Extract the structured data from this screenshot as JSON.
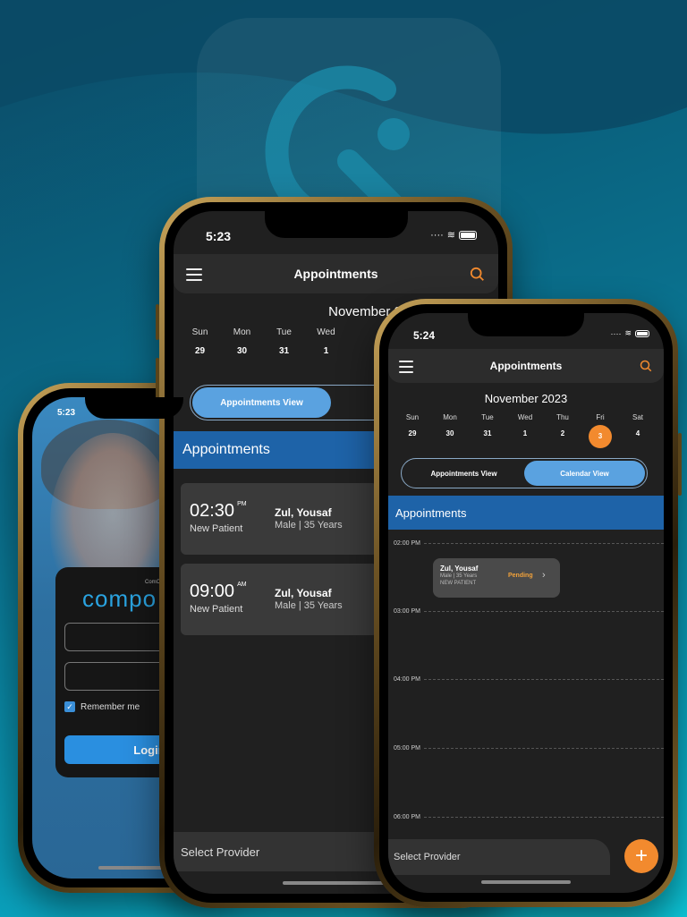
{
  "colors": {
    "accent_orange": "#f28a2e",
    "app_blue": "#1e63a8",
    "segment_active": "#5aa2e0",
    "dark_bg": "#202020"
  },
  "login_phone": {
    "status_time": "5:23",
    "brand_small": "ComCloud",
    "brand": "compo",
    "remember_label": "Remember me",
    "login_button": "Login"
  },
  "list_phone": {
    "status_time": "5:23",
    "header_title": "Appointments",
    "month": "November 2023",
    "days": [
      {
        "name": "Sun",
        "num": "29"
      },
      {
        "name": "Mon",
        "num": "30"
      },
      {
        "name": "Tue",
        "num": "31"
      },
      {
        "name": "Wed",
        "num": "1"
      }
    ],
    "segment_active": "Appointments View",
    "section_title": "Appointments",
    "appointments": [
      {
        "time": "02:30",
        "ampm": "PM",
        "type": "New Patient",
        "name": "Zul, Yousaf",
        "meta": "Male | 35 Years"
      },
      {
        "time": "09:00",
        "ampm": "AM",
        "type": "New Patient",
        "name": "Zul, Yousaf",
        "meta": "Male | 35 Years"
      }
    ],
    "provider_label": "Select Provider"
  },
  "cal_phone": {
    "status_time": "5:24",
    "header_title": "Appointments",
    "month": "November 2023",
    "days": [
      {
        "name": "Sun",
        "num": "29"
      },
      {
        "name": "Mon",
        "num": "30"
      },
      {
        "name": "Tue",
        "num": "31"
      },
      {
        "name": "Wed",
        "num": "1"
      },
      {
        "name": "Thu",
        "num": "2"
      },
      {
        "name": "Fri",
        "num": "3"
      },
      {
        "name": "Sat",
        "num": "4"
      }
    ],
    "selected_day": "3",
    "segment_left": "Appointments View",
    "segment_right": "Calendar View",
    "section_title": "Appointments",
    "time_slots": [
      "02:00 PM",
      "03:00 PM",
      "04:00 PM",
      "05:00 PM",
      "06:00 PM"
    ],
    "event": {
      "name": "Zul, Yousaf",
      "meta": "Male | 35 Years",
      "type": "NEW PATIENT",
      "status": "Pending"
    },
    "provider_label": "Select Provider",
    "fab_symbol": "+"
  }
}
